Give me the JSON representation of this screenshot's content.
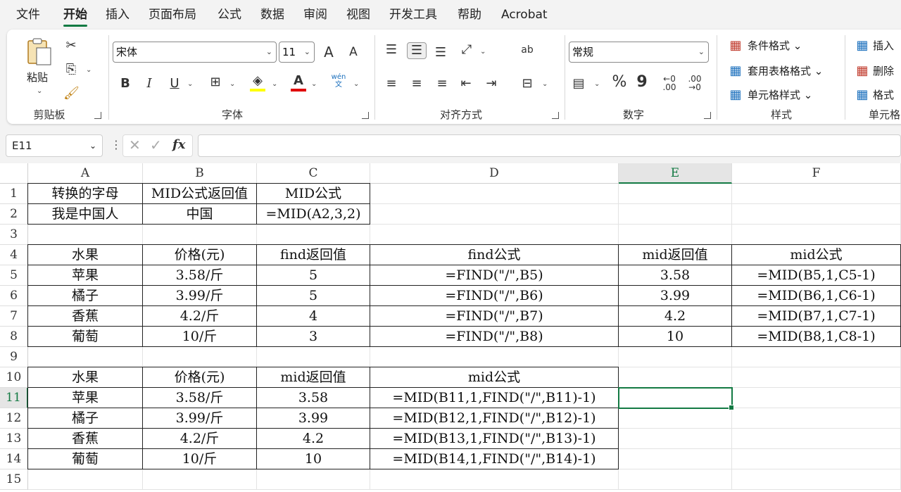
{
  "menu": [
    "文件",
    "开始",
    "插入",
    "页面布局",
    "公式",
    "数据",
    "审阅",
    "视图",
    "开发工具",
    "帮助",
    "Acrobat"
  ],
  "ribbon": {
    "clipboard": {
      "label": "剪贴板",
      "paste": "粘贴"
    },
    "font": {
      "label": "字体",
      "name": "宋体",
      "size": "11",
      "bold": "B",
      "italic": "I",
      "underline": "U",
      "grow": "A",
      "shrink": "A",
      "phonetic_top": "wén",
      "phonetic_bottom": "文"
    },
    "alignment": {
      "label": "对齐方式",
      "wrap": "ab"
    },
    "number": {
      "label": "数字",
      "format": "常规",
      "percent": "%",
      "comma": "9"
    },
    "styles": {
      "label": "样式",
      "cond_format": "条件格式",
      "table_format": "套用表格格式",
      "cell_style": "单元格样式"
    },
    "cells": {
      "label": "单元格",
      "insert": "插入",
      "delete": "删除",
      "format": "格式"
    }
  },
  "formula_bar": {
    "name_box": "E11",
    "fx": "fx",
    "value": ""
  },
  "columns": [
    "A",
    "B",
    "C",
    "D",
    "E",
    "F"
  ],
  "rows": [
    "1",
    "2",
    "3",
    "4",
    "5",
    "6",
    "7",
    "8",
    "9",
    "10",
    "11",
    "12",
    "13",
    "14",
    "15"
  ],
  "cells": {
    "A1": "转换的字母",
    "B1": "MID公式返回值",
    "C1": "MID公式",
    "A2": "我是中国人",
    "B2": "中国",
    "C2": "=MID(A2,3,2)",
    "A4": "水果",
    "B4": "价格(元)",
    "C4": "find返回值",
    "D4": "find公式",
    "E4": "mid返回值",
    "F4": "mid公式",
    "A5": "苹果",
    "B5": "3.58/斤",
    "C5": "5",
    "D5": "=FIND(\"/\",B5)",
    "E5": "3.58",
    "F5": "=MID(B5,1,C5-1)",
    "A6": "橘子",
    "B6": "3.99/斤",
    "C6": "5",
    "D6": "=FIND(\"/\",B6)",
    "E6": "3.99",
    "F6": "=MID(B6,1,C6-1)",
    "A7": "香蕉",
    "B7": "4.2/斤",
    "C7": "4",
    "D7": "=FIND(\"/\",B7)",
    "E7": "4.2",
    "F7": "=MID(B7,1,C7-1)",
    "A8": "葡萄",
    "B8": "10/斤",
    "C8": "3",
    "D8": "=FIND(\"/\",B8)",
    "E8": "10",
    "F8": "=MID(B8,1,C8-1)",
    "A10": "水果",
    "B10": "价格(元)",
    "C10": "mid返回值",
    "D10": "mid公式",
    "A11": "苹果",
    "B11": "3.58/斤",
    "C11": "3.58",
    "D11": "=MID(B11,1,FIND(\"/\",B11)-1)",
    "A12": "橘子",
    "B12": "3.99/斤",
    "C12": "3.99",
    "D12": "=MID(B12,1,FIND(\"/\",B12)-1)",
    "A13": "香蕉",
    "B13": "4.2/斤",
    "C13": "4.2",
    "D13": "=MID(B13,1,FIND(\"/\",B13)-1)",
    "A14": "葡萄",
    "B14": "10/斤",
    "C14": "10",
    "D14": "=MID(B14,1,FIND(\"/\",B14)-1)"
  },
  "colors": {
    "accent": "#137a43",
    "highlight_yellow": "#ffff00",
    "font_red": "#e00000"
  }
}
